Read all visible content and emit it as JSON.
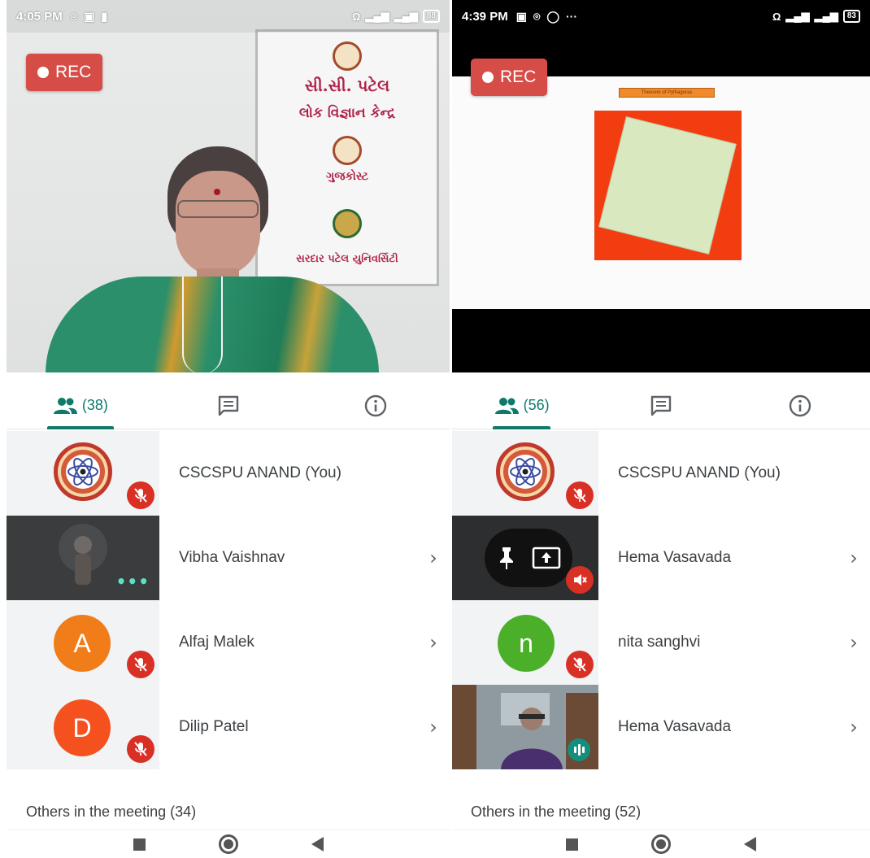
{
  "left": {
    "status": {
      "time": "4:05 PM",
      "battery": "88"
    },
    "rec_label": "REC",
    "banner": {
      "line1": "સી.સી. પટેલ",
      "line2": "લોક વિજ્ઞાન કેન્દ્ર",
      "line3": "ગુજકોસ્ટ",
      "line4": "સરદાર પટેલ યુનિવર્સિટી"
    },
    "tabs": {
      "people_count": "(38)"
    },
    "participants": [
      {
        "name": "CSCSPU ANAND (You)",
        "avatar": "logo",
        "status": "muted"
      },
      {
        "name": "Vibha Vaishnav",
        "avatar": "video",
        "status": "more"
      },
      {
        "name": "Alfaj Malek",
        "avatar": "A",
        "avatar_color": "#f07d1a",
        "status": "muted"
      },
      {
        "name": "Dilip Patel",
        "avatar": "D",
        "avatar_color": "#f4511e",
        "status": "muted"
      }
    ],
    "others_label": "Others in the meeting (34)"
  },
  "right": {
    "status": {
      "time": "4:39 PM",
      "battery": "83"
    },
    "rec_label": "REC",
    "slide_title": "Theorem of Pythagoras",
    "tabs": {
      "people_count": "(56)"
    },
    "participants": [
      {
        "name": "CSCSPU ANAND (You)",
        "avatar": "logo",
        "status": "muted"
      },
      {
        "name": "Hema Vasavada",
        "avatar": "pin-present",
        "status": "muted"
      },
      {
        "name": "nita sanghvi",
        "avatar": "n",
        "avatar_color": "#4caf2a",
        "status": "muted"
      },
      {
        "name": "Hema Vasavada",
        "avatar": "video",
        "status": "speaking"
      }
    ],
    "others_label": "Others in the meeting (52)"
  },
  "icons": [
    "people-icon",
    "chat-icon",
    "info-icon",
    "mic-off-icon",
    "chevron-right-icon",
    "pin-icon",
    "present-icon",
    "speaking-icon"
  ],
  "colors": {
    "accent": "#0d7a6c",
    "rec": "#d64c47",
    "mute": "#d93025"
  },
  "chevron": "›"
}
